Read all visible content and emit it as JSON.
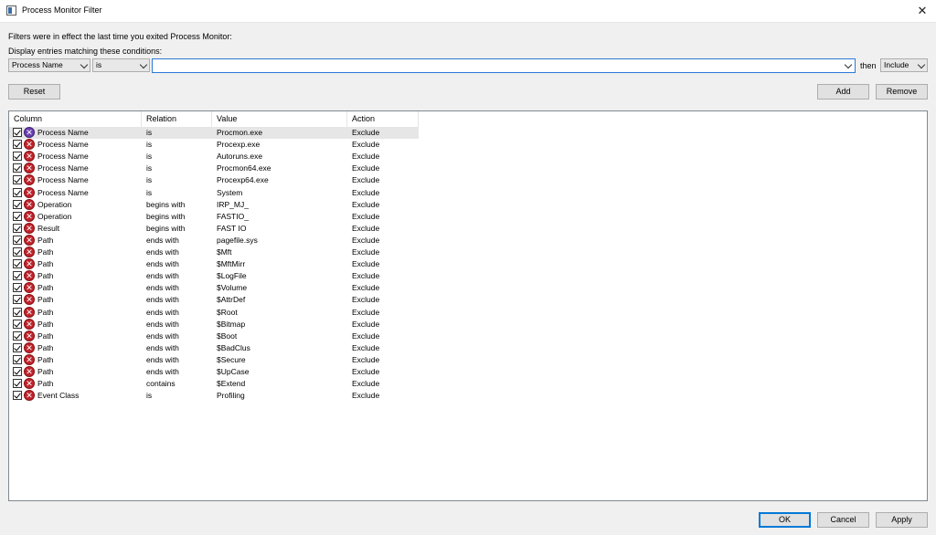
{
  "window": {
    "title": "Process Monitor Filter",
    "close_glyph": "✕"
  },
  "info_text": "Filters were in effect the last time you exited Process Monitor:",
  "conditions_label": "Display entries matching these conditions:",
  "editor": {
    "column_select": "Process Name",
    "relation_select": "is",
    "value_input": "",
    "then_label": "then",
    "action_select": "Include"
  },
  "buttons": {
    "reset": "Reset",
    "add": "Add",
    "remove": "Remove",
    "ok": "OK",
    "cancel": "Cancel",
    "apply": "Apply"
  },
  "table": {
    "headers": {
      "column": "Column",
      "relation": "Relation",
      "value": "Value",
      "action": "Action"
    },
    "rows": [
      {
        "column": "Process Name",
        "relation": "is",
        "value": "Procmon.exe",
        "action": "Exclude"
      },
      {
        "column": "Process Name",
        "relation": "is",
        "value": "Procexp.exe",
        "action": "Exclude"
      },
      {
        "column": "Process Name",
        "relation": "is",
        "value": "Autoruns.exe",
        "action": "Exclude"
      },
      {
        "column": "Process Name",
        "relation": "is",
        "value": "Procmon64.exe",
        "action": "Exclude"
      },
      {
        "column": "Process Name",
        "relation": "is",
        "value": "Procexp64.exe",
        "action": "Exclude"
      },
      {
        "column": "Process Name",
        "relation": "is",
        "value": "System",
        "action": "Exclude"
      },
      {
        "column": "Operation",
        "relation": "begins with",
        "value": "IRP_MJ_",
        "action": "Exclude"
      },
      {
        "column": "Operation",
        "relation": "begins with",
        "value": "FASTIO_",
        "action": "Exclude"
      },
      {
        "column": "Result",
        "relation": "begins with",
        "value": "FAST IO",
        "action": "Exclude"
      },
      {
        "column": "Path",
        "relation": "ends with",
        "value": "pagefile.sys",
        "action": "Exclude"
      },
      {
        "column": "Path",
        "relation": "ends with",
        "value": "$Mft",
        "action": "Exclude"
      },
      {
        "column": "Path",
        "relation": "ends with",
        "value": "$MftMirr",
        "action": "Exclude"
      },
      {
        "column": "Path",
        "relation": "ends with",
        "value": "$LogFile",
        "action": "Exclude"
      },
      {
        "column": "Path",
        "relation": "ends with",
        "value": "$Volume",
        "action": "Exclude"
      },
      {
        "column": "Path",
        "relation": "ends with",
        "value": "$AttrDef",
        "action": "Exclude"
      },
      {
        "column": "Path",
        "relation": "ends with",
        "value": "$Root",
        "action": "Exclude"
      },
      {
        "column": "Path",
        "relation": "ends with",
        "value": "$Bitmap",
        "action": "Exclude"
      },
      {
        "column": "Path",
        "relation": "ends with",
        "value": "$Boot",
        "action": "Exclude"
      },
      {
        "column": "Path",
        "relation": "ends with",
        "value": "$BadClus",
        "action": "Exclude"
      },
      {
        "column": "Path",
        "relation": "ends with",
        "value": "$Secure",
        "action": "Exclude"
      },
      {
        "column": "Path",
        "relation": "ends with",
        "value": "$UpCase",
        "action": "Exclude"
      },
      {
        "column": "Path",
        "relation": "contains",
        "value": "$Extend",
        "action": "Exclude"
      },
      {
        "column": "Event Class",
        "relation": "is",
        "value": "Profiling",
        "action": "Exclude"
      }
    ]
  },
  "icons": {
    "checkbox": "checkbox-checked-icon",
    "exclude": "exclude-x-icon",
    "exclude_glyph": "✕"
  },
  "colors": {
    "exclude_icon": "#c0242b",
    "focus_border": "#0078d7",
    "selected_row": "#e6e6e6"
  }
}
